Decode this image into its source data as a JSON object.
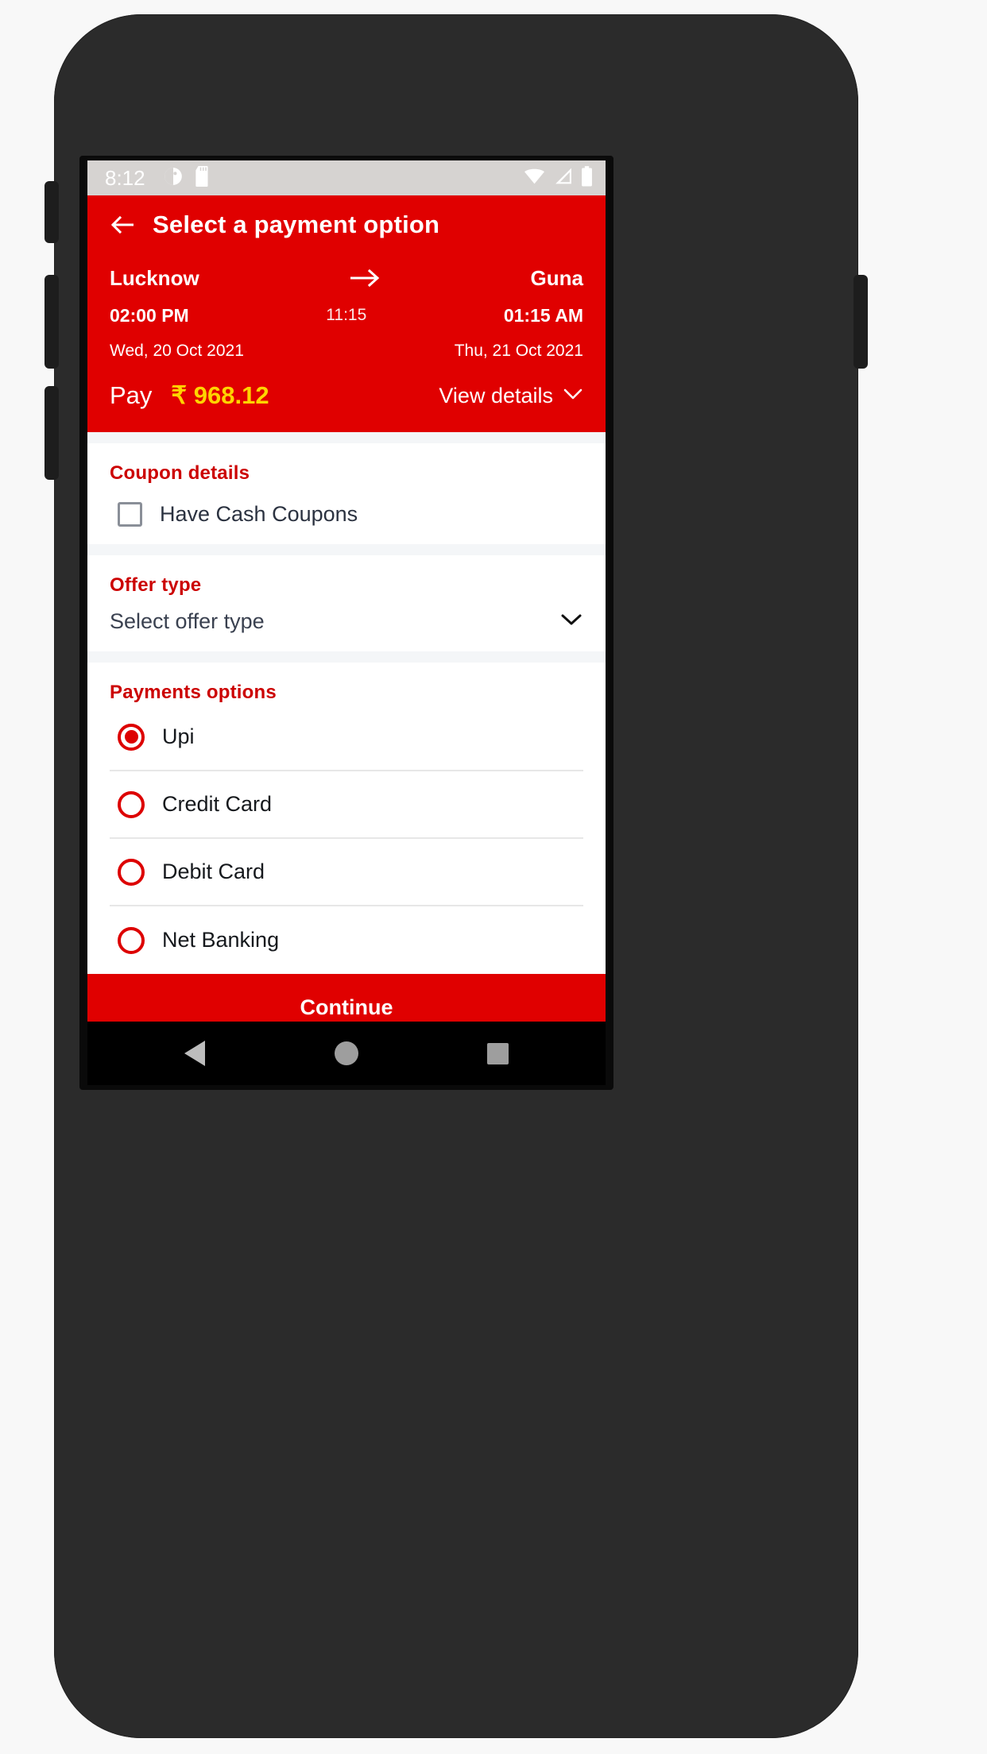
{
  "theme": {
    "brand_red": "#e00000",
    "section_red": "#cc0000",
    "amount_yellow": "#ffd400",
    "status_bar_bg": "#d6d3d1"
  },
  "status_bar": {
    "time": "8:12",
    "left_icons": [
      "do-not-disturb-icon",
      "sd-card-icon"
    ],
    "right_icons": [
      "wifi-icon",
      "cellular-signal-icon",
      "battery-icon"
    ]
  },
  "appbar": {
    "back_icon": "arrow-left-icon",
    "title": "Select a payment option"
  },
  "journey": {
    "origin_city": "Lucknow",
    "destination_city": "Guna",
    "departure_time": "02:00 PM",
    "arrival_time": "01:15 AM",
    "duration": "11:15",
    "departure_date": "Wed, 20 Oct 2021",
    "arrival_date": "Thu, 21 Oct 2021",
    "direction_icon": "arrow-right-icon"
  },
  "pay": {
    "label": "Pay",
    "amount": "₹ 968.12",
    "view_details_label": "View details",
    "view_details_icon": "chevron-down-icon"
  },
  "coupon": {
    "title": "Coupon details",
    "checkbox_label": "Have Cash Coupons",
    "checked": false
  },
  "offer": {
    "title": "Offer type",
    "selected_value": "Select offer type",
    "chevron_icon": "chevron-down-icon"
  },
  "payments": {
    "title": "Payments options",
    "options": [
      {
        "label": "Upi",
        "selected": true
      },
      {
        "label": "Credit Card",
        "selected": false
      },
      {
        "label": "Debit Card",
        "selected": false
      },
      {
        "label": "Net Banking",
        "selected": false
      }
    ]
  },
  "footer": {
    "continue_label": "Continue"
  },
  "navbar": {
    "back": "back-triangle-icon",
    "home": "home-circle-icon",
    "recents": "recents-square-icon"
  }
}
